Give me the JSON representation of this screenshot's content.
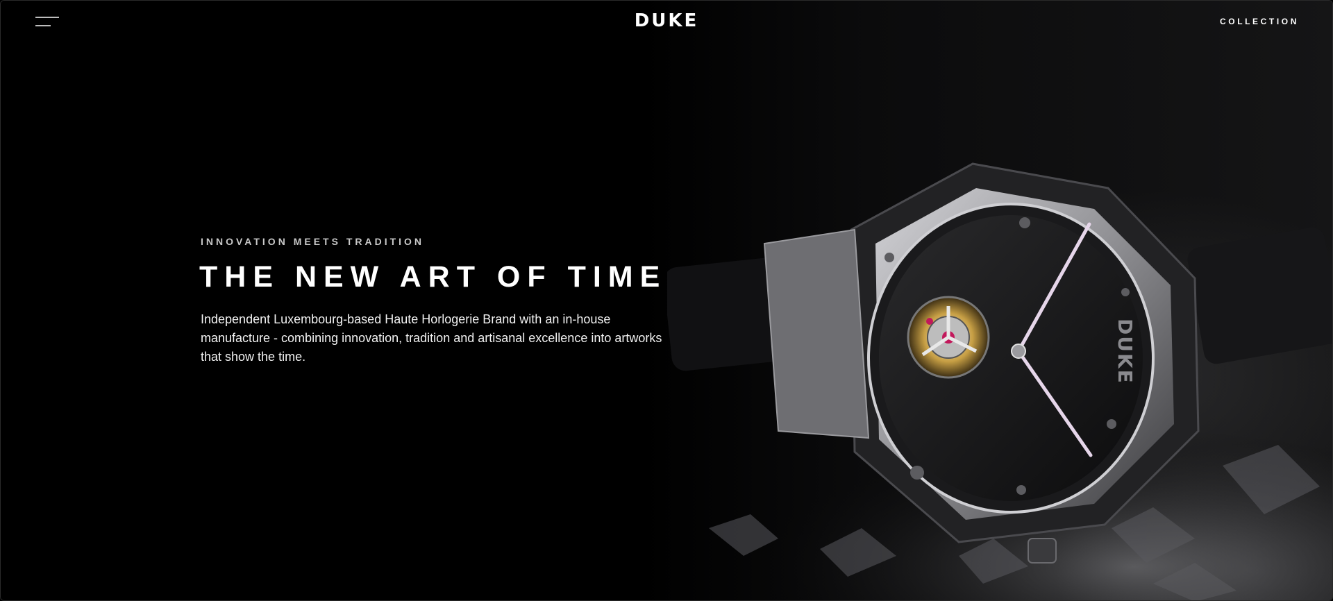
{
  "header": {
    "menu_icon": "hamburger-menu-icon",
    "logo": "DUKE",
    "nav_collection": "COLLECTION"
  },
  "hero": {
    "eyebrow": "INNOVATION MEETS TRADITION",
    "headline": "THE NEW ART OF TIME",
    "lead_line1": "Independent Luxembourg-based Haute Horlogerie Brand with an in-house",
    "lead_line2": "manufacture - combining innovation, tradition and artisanal excellence into artworks",
    "lead_line3": "that show the time."
  },
  "product_image": {
    "dial_logo": "DUKE",
    "colors": {
      "background": "#000000",
      "case": "#8a8a8e",
      "accent_ruby": "#c2185b",
      "gold": "#c8a045"
    }
  }
}
